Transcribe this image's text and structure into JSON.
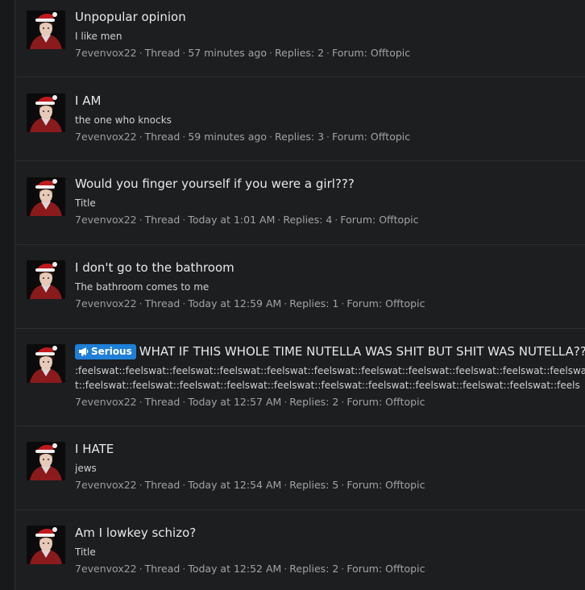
{
  "results": [
    {
      "title": "Unpopular opinion",
      "snippet": "I like men",
      "user": "7evenvox22",
      "type": "Thread",
      "time": "57 minutes ago",
      "replies": "Replies: 2",
      "forum_label": "Forum:",
      "forum": "Offtopic"
    },
    {
      "title": "I AM",
      "snippet": "the one who knocks",
      "user": "7evenvox22",
      "type": "Thread",
      "time": "59 minutes ago",
      "replies": "Replies: 3",
      "forum_label": "Forum:",
      "forum": "Offtopic"
    },
    {
      "title": "Would you finger yourself if you were a girl???",
      "snippet": "Title",
      "user": "7evenvox22",
      "type": "Thread",
      "time": "Today at 1:01 AM",
      "replies": "Replies: 4",
      "forum_label": "Forum:",
      "forum": "Offtopic"
    },
    {
      "title": "I don't go to the bathroom",
      "snippet": "The bathroom comes to me",
      "user": "7evenvox22",
      "type": "Thread",
      "time": "Today at 12:59 AM",
      "replies": "Replies: 1",
      "forum_label": "Forum:",
      "forum": "Offtopic"
    },
    {
      "prefix": "Serious",
      "title": "WHAT IF THIS WHOLE TIME NUTELLA WAS SHIT BUT SHIT WAS NUTELLA???",
      "snippet": ":feelswat::feelswat::feelswat::feelswat::feelswat::feelswat::feelswat::feelswat::feelswat::feelswat::feelswat::feelswat::feelswat::feelswat::feelswat::feelswat::feelswat::feelswat::feelswat::feelswat::feelswat::feelsw...",
      "user": "7evenvox22",
      "type": "Thread",
      "time": "Today at 12:57 AM",
      "replies": "Replies: 2",
      "forum_label": "Forum:",
      "forum": "Offtopic"
    },
    {
      "title": "I HATE",
      "snippet": "jews",
      "user": "7evenvox22",
      "type": "Thread",
      "time": "Today at 12:54 AM",
      "replies": "Replies: 5",
      "forum_label": "Forum:",
      "forum": "Offtopic"
    },
    {
      "title": "Am I lowkey schizo?",
      "snippet": "Title",
      "user": "7evenvox22",
      "type": "Thread",
      "time": "Today at 12:52 AM",
      "replies": "Replies: 2",
      "forum_label": "Forum:",
      "forum": "Offtopic"
    }
  ],
  "colors": {
    "background": "#1d1e20",
    "prefix_badge": "#1f7fd6",
    "divider": "#2c2d30"
  },
  "icons": {
    "avatar": "santa-hat-avatar",
    "prefix": "megaphone-icon"
  }
}
